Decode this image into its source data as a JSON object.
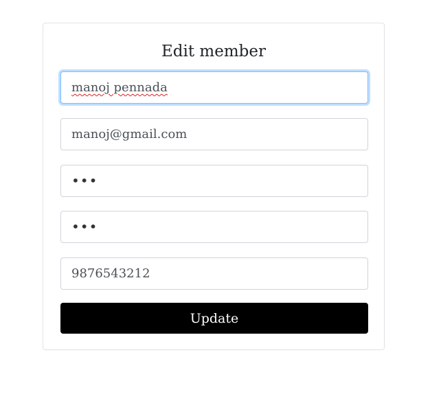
{
  "form": {
    "title": "Edit member",
    "name_value": "manoj pennada",
    "email_value": "manoj@gmail.com",
    "password_value": "•••",
    "confirm_password_value": "•••",
    "phone_value": "9876543212",
    "submit_label": "Update"
  },
  "colors": {
    "button_bg": "#000000",
    "button_text": "#ffffff",
    "focus_border": "#80bdff",
    "input_border": "#ced4da"
  }
}
